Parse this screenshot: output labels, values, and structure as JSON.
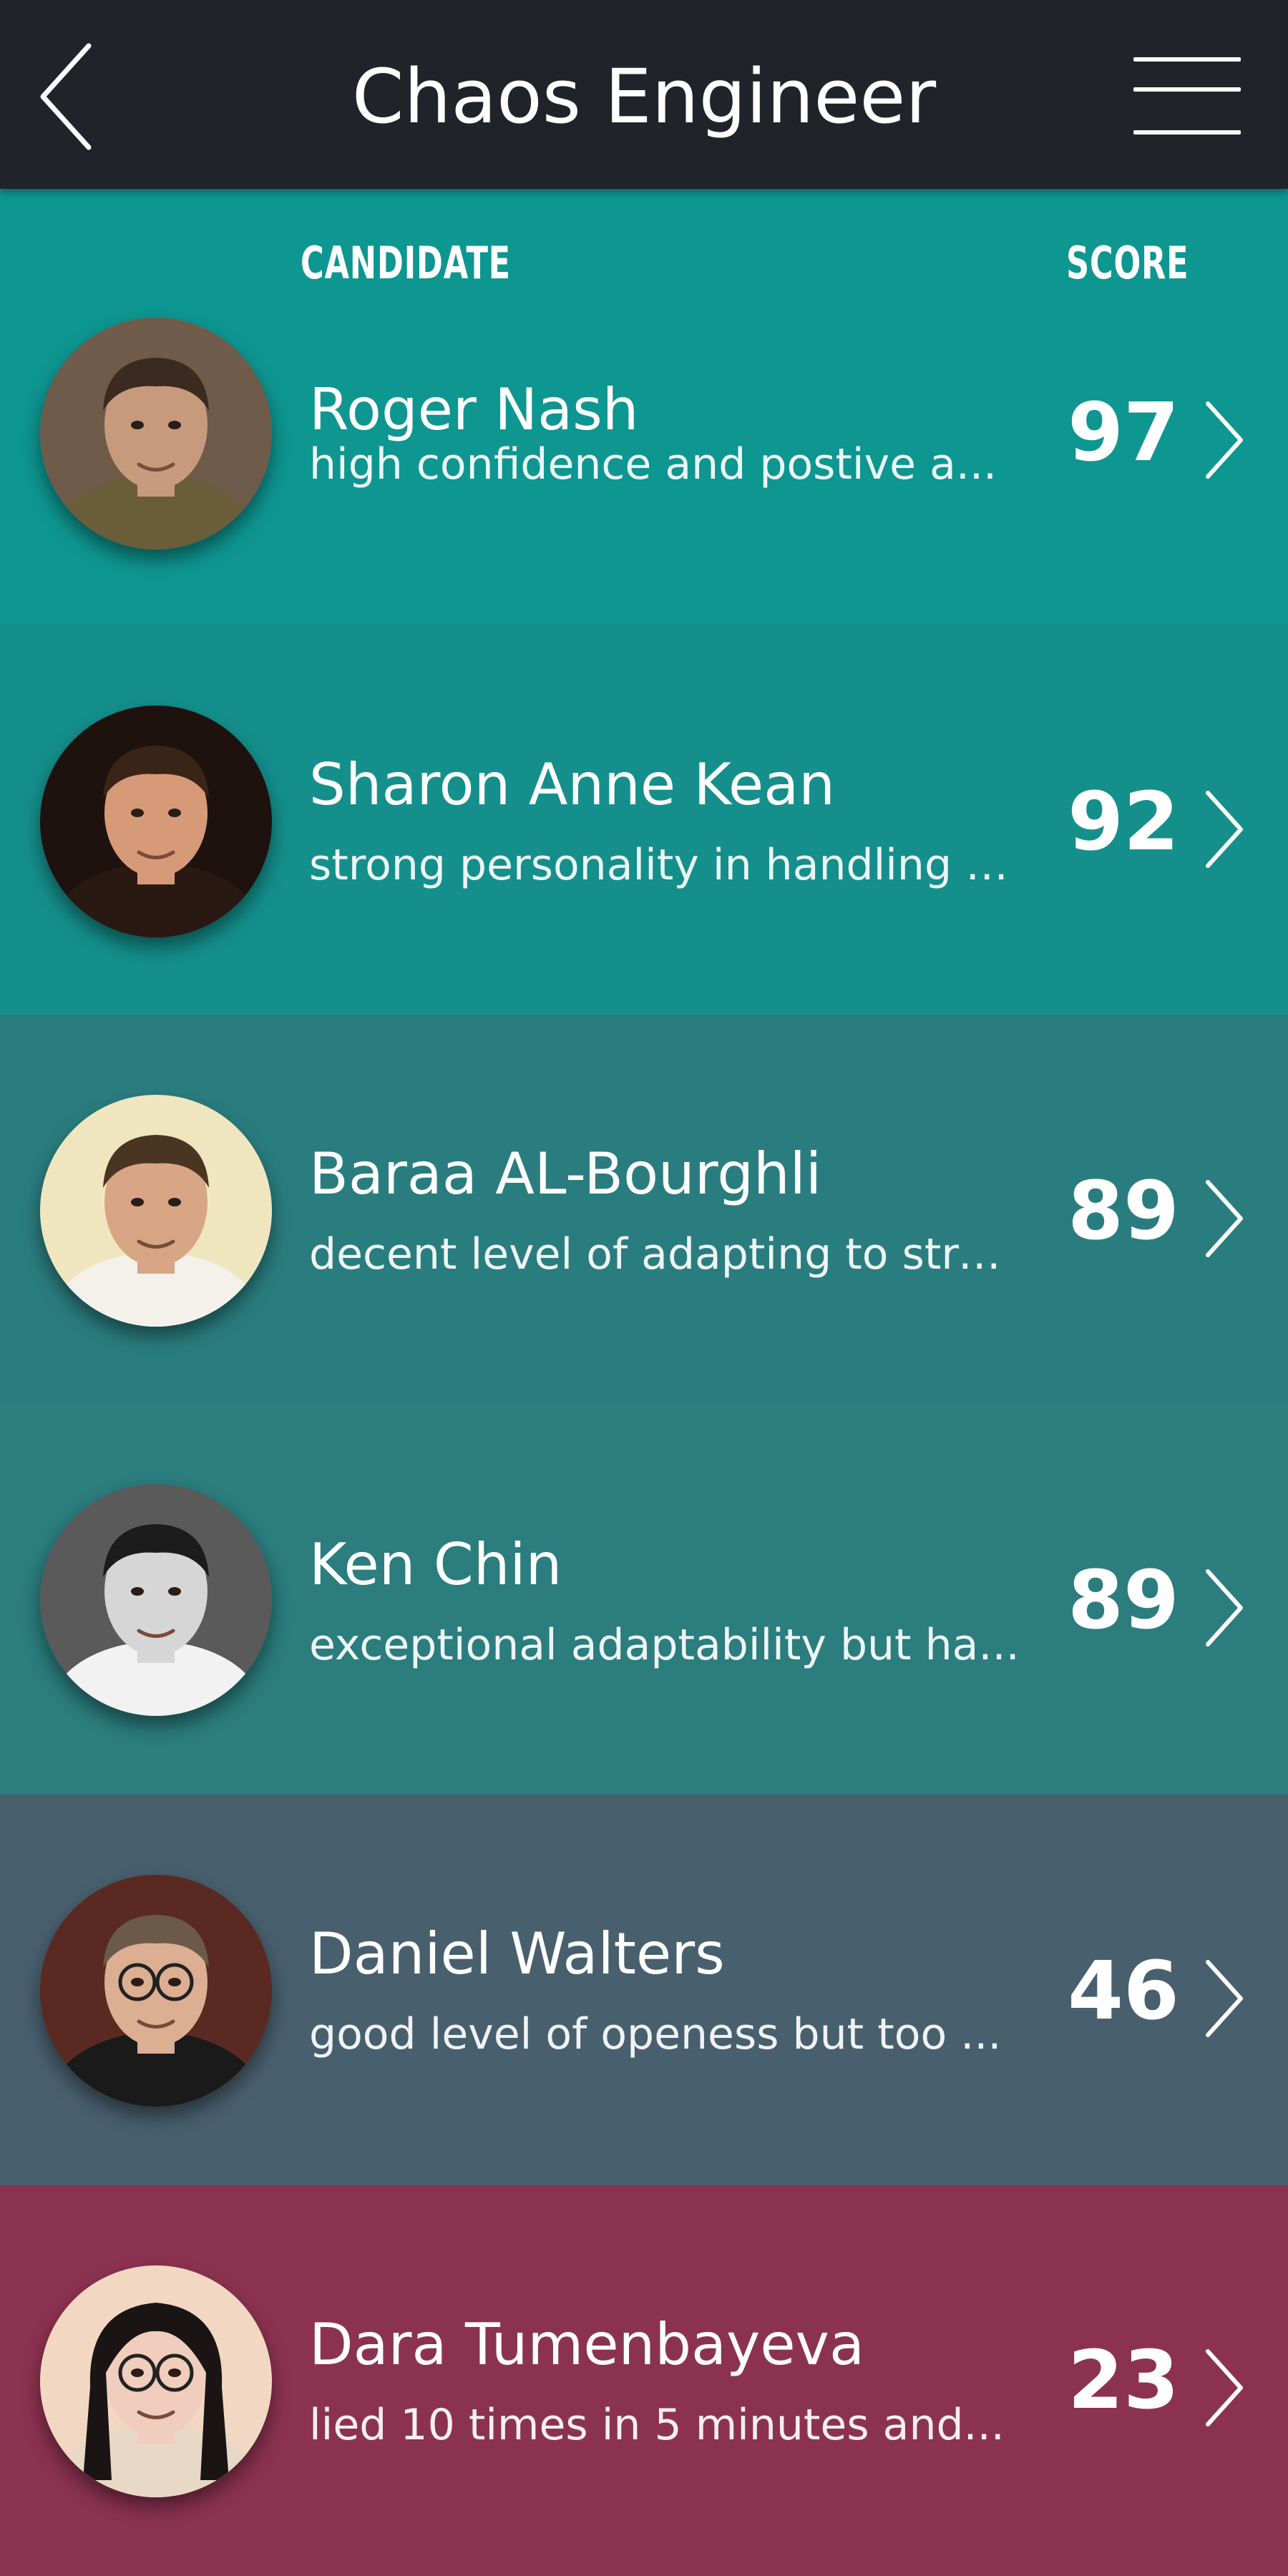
{
  "header": {
    "title": "Chaos Engineer",
    "back_icon": "chevron-left-icon",
    "menu_icon": "hamburger-menu-icon"
  },
  "columns": {
    "candidate": "CANDIDATE",
    "score": "SCORE"
  },
  "candidates": [
    {
      "name": "Roger Nash",
      "description": "high confidence and postive a...",
      "score": "97",
      "row_color": "#0e9691",
      "avatar_bg": "#6f5b49",
      "avatar_skin": "#c79a7e",
      "avatar_hair": "#3a2a20",
      "avatar_shirt": "#6a5d3a"
    },
    {
      "name": "Sharon Anne Kean",
      "description": "strong personality in handling c...",
      "score": "92",
      "row_color": "#148f8c",
      "avatar_bg": "#1e120e",
      "avatar_skin": "#d79a78",
      "avatar_hair": "#3a2418",
      "avatar_shirt": "#2a1812"
    },
    {
      "name": "Baraa AL-Bourghli",
      "description": "decent level of adapting to stre...",
      "score": "89",
      "row_color": "#2a7d7f",
      "avatar_bg": "#efe6c0",
      "avatar_skin": "#d8a585",
      "avatar_hair": "#4a3422",
      "avatar_shirt": "#f4f1ea"
    },
    {
      "name": "Ken Chin",
      "description": "exceptional adaptability but ha...",
      "score": "89",
      "row_color": "#2b7d7e",
      "avatar_bg": "#5a5a5a",
      "avatar_skin": "#d6d6d6",
      "avatar_hair": "#1c1c1c",
      "avatar_shirt": "#f2f2f2"
    },
    {
      "name": "Daniel Walters",
      "description": "good level of openess but too ...",
      "score": "46",
      "row_color": "#485f6e",
      "avatar_bg": "#5a2a22",
      "avatar_skin": "#dcae92",
      "avatar_hair": "#6b5a4a",
      "avatar_shirt": "#1a1a1a"
    },
    {
      "name": "Dara Tumenbayeva",
      "description": "lied 10 times in 5 minutes and...",
      "score": "23",
      "row_color": "#8c3251",
      "avatar_bg": "#f2d8c2",
      "avatar_skin": "#f0cdbc",
      "avatar_hair": "#1a1514",
      "avatar_shirt": "#e8d9c6"
    }
  ]
}
